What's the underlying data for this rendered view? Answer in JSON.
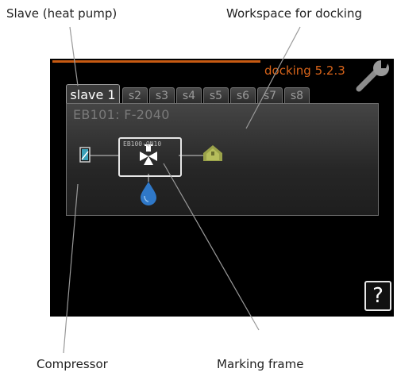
{
  "callouts": {
    "slave": "Slave (heat pump)",
    "workspace": "Workspace for docking",
    "compressor": "Compressor",
    "marking": "Marking frame"
  },
  "screen": {
    "menu_title": "docking 5.2.3",
    "tabs": [
      {
        "label": "slave 1",
        "active": true
      },
      {
        "label": "s2"
      },
      {
        "label": "s3"
      },
      {
        "label": "s4"
      },
      {
        "label": "s5"
      },
      {
        "label": "s6"
      },
      {
        "label": "s7"
      },
      {
        "label": "s8"
      }
    ],
    "unit_name": "EB101: F-2040",
    "marking_frame_label": "EB100-QN10",
    "help_symbol": "?",
    "icons": {
      "settings": "wrench-icon",
      "compressor": "compressor-icon",
      "valve": "three-way-valve-icon",
      "hot_water": "water-drop-icon",
      "house": "house-heating-icon"
    },
    "colors": {
      "accent": "#d8641a",
      "screen_bg": "#000000"
    }
  }
}
